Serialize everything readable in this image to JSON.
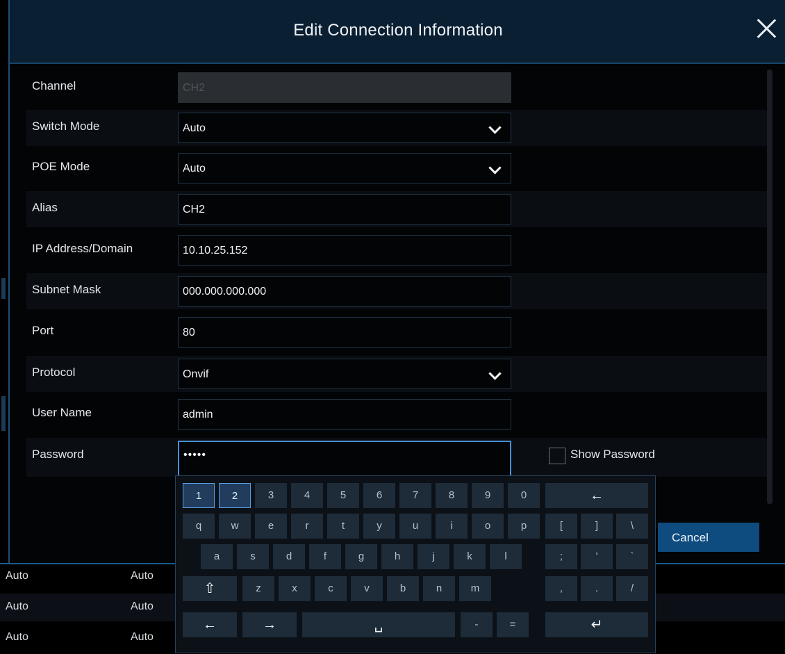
{
  "dialog": {
    "title": "Edit Connection Information",
    "close_icon": "close-icon",
    "cancel_label": "Cancel"
  },
  "form": {
    "channel": {
      "label": "Channel",
      "value": "CH2"
    },
    "switch_mode": {
      "label": "Switch Mode",
      "value": "Auto"
    },
    "poe_mode": {
      "label": "POE Mode",
      "value": "Auto"
    },
    "alias": {
      "label": "Alias",
      "value": "CH2"
    },
    "ip": {
      "label": "IP Address/Domain",
      "value": "10.10.25.152"
    },
    "subnet": {
      "label": "Subnet Mask",
      "value": "000.000.000.000"
    },
    "port": {
      "label": "Port",
      "value": "80"
    },
    "protocol": {
      "label": "Protocol",
      "value": "Onvif"
    },
    "username": {
      "label": "User Name",
      "value": "admin"
    },
    "password": {
      "label": "Password",
      "value": "•••••"
    },
    "show_password": {
      "label": "Show Password",
      "checked": false
    }
  },
  "keyboard": {
    "row1": [
      "1",
      "2",
      "3",
      "4",
      "5",
      "6",
      "7",
      "8",
      "9",
      "0"
    ],
    "row2": [
      "q",
      "w",
      "e",
      "r",
      "t",
      "y",
      "u",
      "i",
      "o",
      "p"
    ],
    "row3": [
      "a",
      "s",
      "d",
      "f",
      "g",
      "h",
      "j",
      "k",
      "l"
    ],
    "row4": [
      "z",
      "x",
      "c",
      "v",
      "b",
      "n",
      "m"
    ],
    "symbols_row2": [
      "[",
      "]",
      "\\"
    ],
    "symbols_row3": [
      ";",
      "'",
      "`"
    ],
    "symbols_row4": [
      ",",
      ".",
      "/"
    ],
    "row5_symbols": [
      "-",
      "="
    ],
    "backspace": "←",
    "shift": "⇧",
    "left": "←",
    "right": "→",
    "space": "␣",
    "enter": "↵"
  },
  "background_table": {
    "rows": [
      [
        "Auto",
        "Auto"
      ],
      [
        "Auto",
        "Auto"
      ],
      [
        "Auto",
        "Auto"
      ]
    ]
  },
  "colors": {
    "accent": "#4a8fd4",
    "titlebar": "#0b1f33",
    "button": "#0e4b7f"
  }
}
